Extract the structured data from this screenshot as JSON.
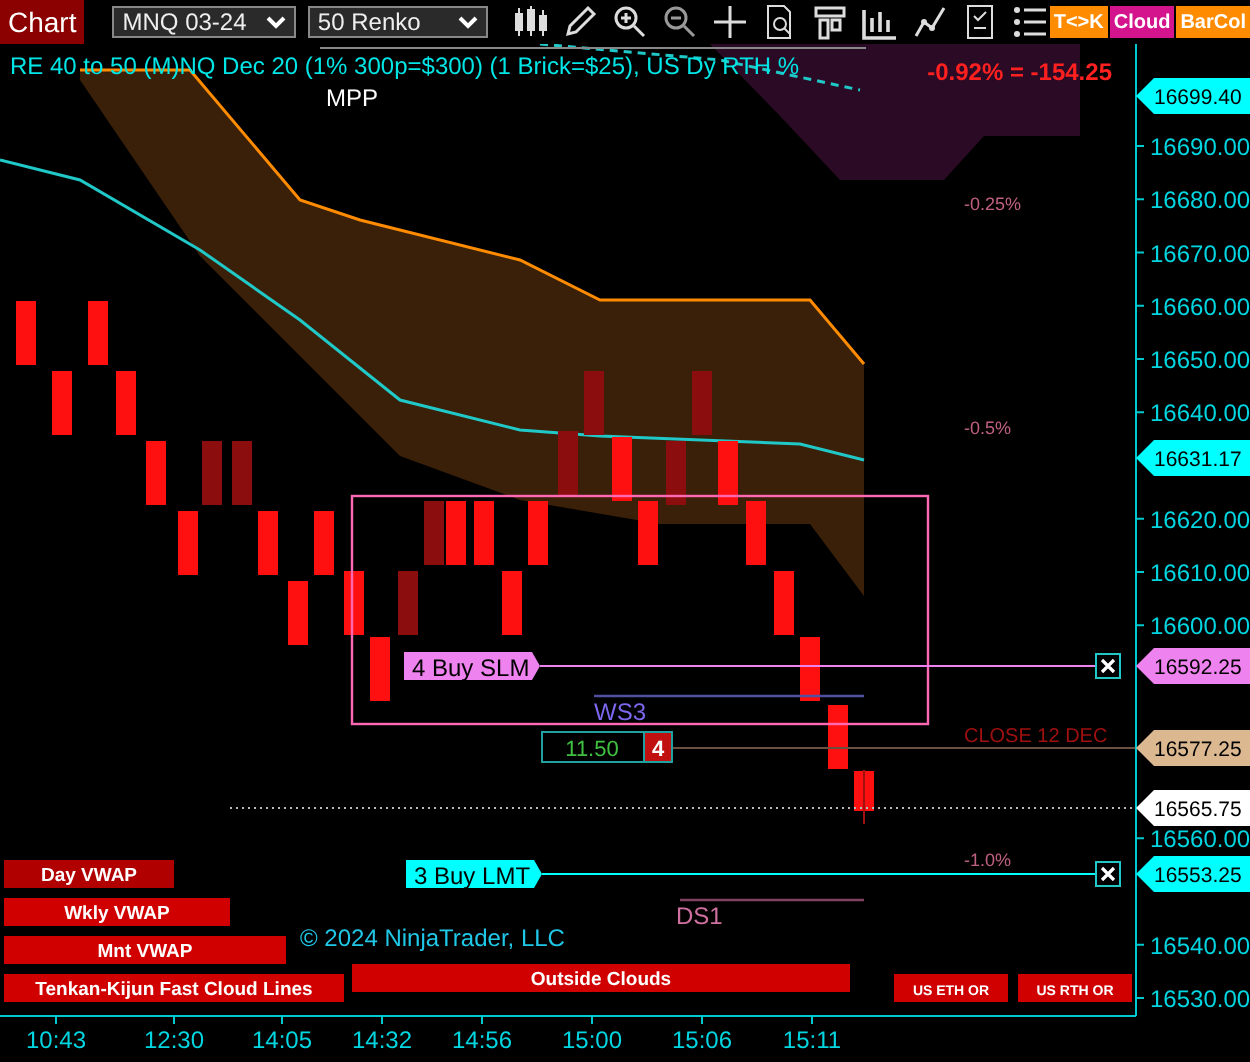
{
  "toolbar": {
    "chart_button": "Chart",
    "instrument": "MNQ 03-24",
    "bar_type": "50 Renko",
    "toggles": [
      {
        "label": "T<>K",
        "color": "#ff8c00"
      },
      {
        "label": "Cloud",
        "color": "#d4148c"
      },
      {
        "label": "BarCol",
        "color": "#ff8c00"
      }
    ]
  },
  "chart": {
    "title": "RE 40 to 50 (M)NQ Dec 20 (1% 300p=$300) (1 Brick=$25), US Dy RTH %",
    "mpp_label": "MPP",
    "pnl": "-0.92% = -154.25",
    "percent_levels": [
      "-0.25%",
      "-0.5%",
      "-1.0%"
    ],
    "orders": [
      {
        "label": "4 Buy SLM",
        "price": "16592.25",
        "color": "#ee82ee"
      },
      {
        "label": "3 Buy LMT",
        "price": "16553.25",
        "color": "#00ffff"
      }
    ],
    "position": {
      "pnl": "11.50",
      "quantity": "4",
      "price": "16577.25",
      "note": "CLOSE 12 DEC"
    },
    "last_price": "16565.75",
    "price_tags": [
      {
        "label": "16699.40"
      },
      {
        "label": "16631.17"
      }
    ],
    "level_labels": [
      "WS3",
      "DS1"
    ],
    "y_ticks": [
      "16690.00",
      "16680.00",
      "16670.00",
      "16660.00",
      "16650.00",
      "16640.00",
      "16620.00",
      "16610.00",
      "16600.00",
      "16560.00",
      "16540.00",
      "16530.00"
    ],
    "x_ticks": [
      "10:43",
      "12:30",
      "14:05",
      "14:32",
      "14:56",
      "15:00",
      "15:06",
      "15:11"
    ],
    "buttons": [
      "Day VWAP",
      "Wkly VWAP",
      "Mnt VWAP",
      "Tenkan-Kijun Fast Cloud Lines",
      "Outside Clouds",
      "US ETH OR",
      "US RTH OR"
    ],
    "copyright": "© 2024 NinjaTrader, LLC"
  }
}
